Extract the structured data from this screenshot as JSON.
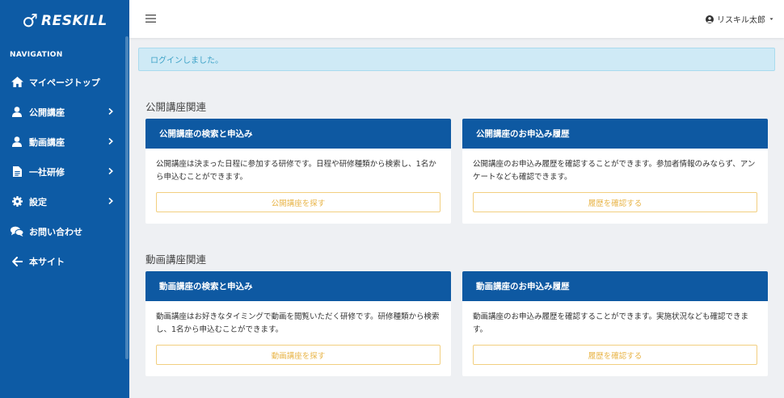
{
  "brand": {
    "logo_mark": "♂",
    "logo_text": "RESKILL"
  },
  "sidebar": {
    "heading": "NAVIGATION",
    "items": [
      {
        "label": "マイページトップ",
        "icon": "home-icon",
        "has_chevron": false
      },
      {
        "label": "公開講座",
        "icon": "user-icon",
        "has_chevron": true
      },
      {
        "label": "動画講座",
        "icon": "user-icon",
        "has_chevron": true
      },
      {
        "label": "一社研修",
        "icon": "document-icon",
        "has_chevron": true
      },
      {
        "label": "設定",
        "icon": "gear-icon",
        "has_chevron": true
      },
      {
        "label": "お問い合わせ",
        "icon": "chat-icon",
        "has_chevron": false
      },
      {
        "label": "本サイト",
        "icon": "arrow-left-icon",
        "has_chevron": false
      }
    ]
  },
  "header": {
    "user_name": "リスキル太郎"
  },
  "alert": {
    "message": "ログインしました。"
  },
  "sections": [
    {
      "title": "公開講座関連",
      "cards": [
        {
          "title": "公開講座の検索と申込み",
          "text": "公開講座は決まった日程に参加する研修です。日程や研修種類から検索し、1名から申込むことができます。",
          "button": "公開講座を探す"
        },
        {
          "title": "公開講座のお申込み履歴",
          "text": "公開講座のお申込み履歴を確認することができます。参加者情報のみならず、アンケートなども確認できます。",
          "button": "履歴を確認する"
        }
      ]
    },
    {
      "title": "動画講座関連",
      "cards": [
        {
          "title": "動画講座の検索と申込み",
          "text": "動画講座はお好きなタイミングで動画を閲覧いただく研修です。研修種類から検索し、1名から申込むことができます。",
          "button": "動画講座を探す"
        },
        {
          "title": "動画講座のお申込み履歴",
          "text": "動画講座のお申込み履歴を確認することができます。実施状況なども確認できます。",
          "button": "履歴を確認する"
        }
      ]
    }
  ]
}
